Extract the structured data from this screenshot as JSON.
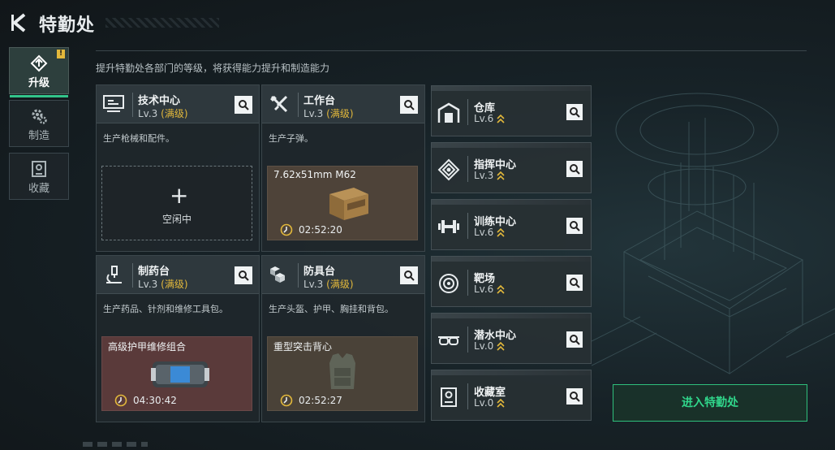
{
  "header": {
    "title": "特勤处"
  },
  "nav": [
    {
      "label": "升级",
      "icon": "upgrade-icon",
      "active": true,
      "badge": "!"
    },
    {
      "label": "制造",
      "icon": "gear-icon",
      "active": false
    },
    {
      "label": "收藏",
      "icon": "collection-icon",
      "active": false
    }
  ],
  "description": "提升特勤处各部门的等级，将获得能力提升和制造能力",
  "cards": [
    {
      "name": "技术中心",
      "level": "Lv.3",
      "max": "(满级)",
      "desc": "生产枪械和配件。",
      "icon": "monitor-icon",
      "slot": {
        "state": "idle",
        "plus": "+",
        "idle_label": "空闲中"
      }
    },
    {
      "name": "工作台",
      "level": "Lv.3",
      "max": "(满级)",
      "desc": "生产子弹。",
      "icon": "tools-icon",
      "slot": {
        "state": "busy",
        "item": "7.62x51mm M62",
        "timer": "02:52:20"
      }
    },
    {
      "name": "制药台",
      "level": "Lv.3",
      "max": "(满级)",
      "desc": "生产药品、针剂和维修工具包。",
      "icon": "microscope-icon",
      "slot": {
        "state": "busy",
        "item": "高级护甲维修组合",
        "timer": "04:30:42"
      }
    },
    {
      "name": "防具台",
      "level": "Lv.3",
      "max": "(满级)",
      "desc": "生产头盔、护甲、胸挂和背包。",
      "icon": "cubes-icon",
      "slot": {
        "state": "busy",
        "item": "重型突击背心",
        "timer": "02:52:27"
      }
    }
  ],
  "facilities": [
    {
      "name": "仓库",
      "level": "Lv.6",
      "icon": "warehouse-icon"
    },
    {
      "name": "指挥中心",
      "level": "Lv.3",
      "icon": "command-icon"
    },
    {
      "name": "训练中心",
      "level": "Lv.6",
      "icon": "dumbbell-icon"
    },
    {
      "name": "靶场",
      "level": "Lv.6",
      "icon": "target-icon"
    },
    {
      "name": "潜水中心",
      "level": "Lv.0",
      "icon": "goggles-icon"
    },
    {
      "name": "收藏室",
      "level": "Lv.0",
      "icon": "collection-room-icon"
    }
  ],
  "enter_button": "进入特勤处",
  "colors": {
    "accent": "#30d68b",
    "max_gold": "#e2b83b"
  }
}
